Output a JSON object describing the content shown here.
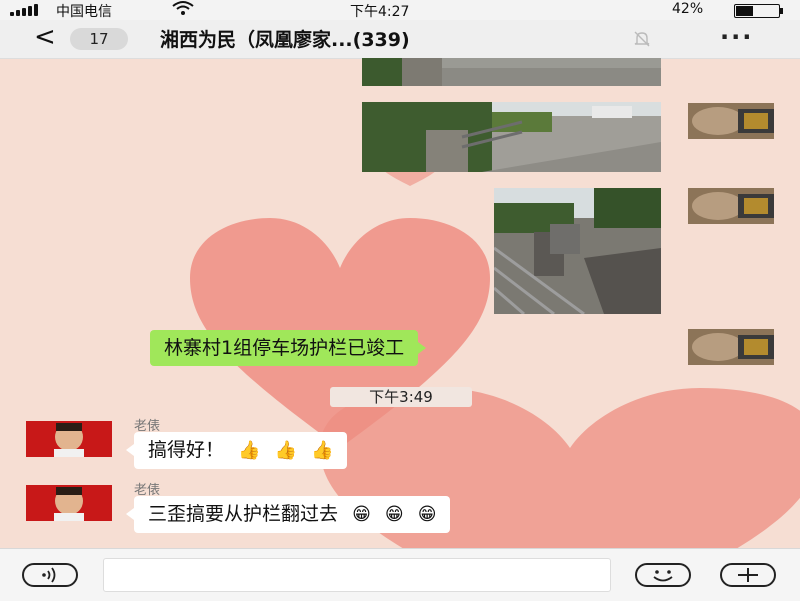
{
  "status_bar": {
    "carrier": "中国电信",
    "time": "下午4:27",
    "battery_percent": "42%",
    "battery_level": 0.42,
    "wifi_icon": "wifi-icon"
  },
  "nav": {
    "back_label": "<",
    "unread_count": "17",
    "title": "湘西为民（凤凰廖家...(339)",
    "mute_icon": "bell-off-icon",
    "more_label": "···"
  },
  "messages": {
    "outgoing_text": "林寨村1组停车场护栏已竣工",
    "time_divider": "下午3:49",
    "reply1_sender": "老俵",
    "reply1_text": "搞得好！",
    "reply1_emojis": [
      "👍",
      "👍",
      "👍"
    ],
    "reply2_sender": "老俵",
    "reply2_text": "三歪搞要从护栏翻过去",
    "reply2_emojis": [
      "😁",
      "😁",
      "😁"
    ]
  },
  "input_bar": {
    "voice_icon": "voice-icon",
    "emoji_icon": "smiley-icon",
    "add_icon": "plus-icon"
  },
  "colors": {
    "chat_bg": "#f6ded3",
    "heart": "#ee8e82",
    "outgoing_bubble": "#a0e75a",
    "incoming_bubble": "#ffffff"
  }
}
